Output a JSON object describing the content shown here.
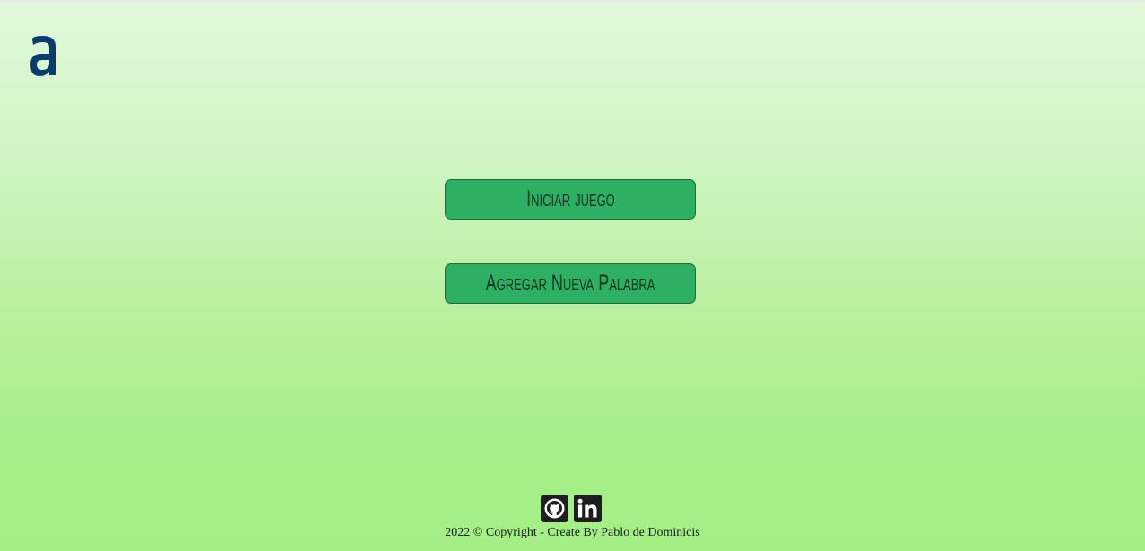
{
  "logo": {
    "icon": "alura-a-logo-icon",
    "color": "#0a3b6f"
  },
  "menu": {
    "start_label": "Iniciar juego",
    "add_word_label": "Agregar Nueva Palabra"
  },
  "social": {
    "github_icon": "github-icon",
    "linkedin_icon": "linkedin-icon"
  },
  "footer": {
    "copyright": "2022 © Copyright - Create By Pablo de Dominicis"
  },
  "colors": {
    "button_bg": "#2db064",
    "button_border": "#1f6b3a",
    "gradient_top": "#e0f8da",
    "gradient_bottom": "#a3ef85"
  }
}
